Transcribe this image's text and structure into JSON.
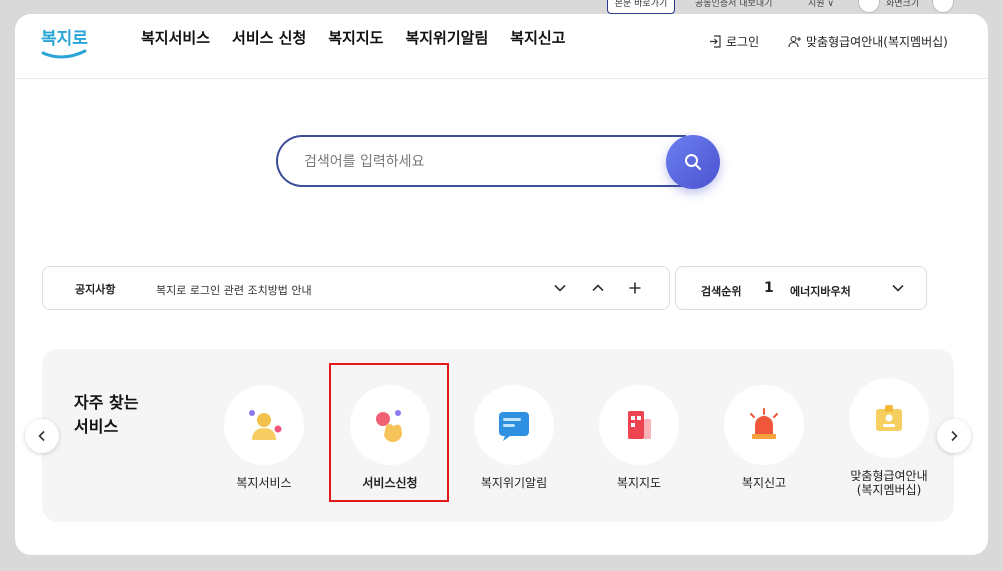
{
  "util": {
    "skip_label": "본문 바로가기",
    "cert_label": "공동인증서 내보내기",
    "lang_label": "지원 ∨",
    "zoom_label": "화면크기"
  },
  "header": {
    "logo_text": "복지로",
    "nav": [
      "복지서비스",
      "서비스 신청",
      "복지지도",
      "복지위기알림",
      "복지신고"
    ],
    "login_label": "로그인",
    "membership_label": "맞춤형급여안내(복지멤버십)"
  },
  "search": {
    "placeholder": "검색어를 입력하세요"
  },
  "notice": {
    "label": "공지사항",
    "text": "복지로 로그인 관련 조치방법 안내"
  },
  "rank": {
    "label": "검색순위",
    "number": "1",
    "term": "에너지바우처"
  },
  "favorites": {
    "title_line1": "자주 찾는",
    "title_line2": "서비스",
    "items": [
      {
        "label": "복지서비스"
      },
      {
        "label": "서비스신청"
      },
      {
        "label": "복지위기알림"
      },
      {
        "label": "복지지도"
      },
      {
        "label": "복지신고"
      },
      {
        "label_line1": "맞춤형급여안내",
        "label_line2": "(복지멤버십)"
      }
    ]
  },
  "colors": {
    "brand": "#3d4d9a",
    "search_btn": "#5a63dd",
    "highlight": "#e01818"
  }
}
